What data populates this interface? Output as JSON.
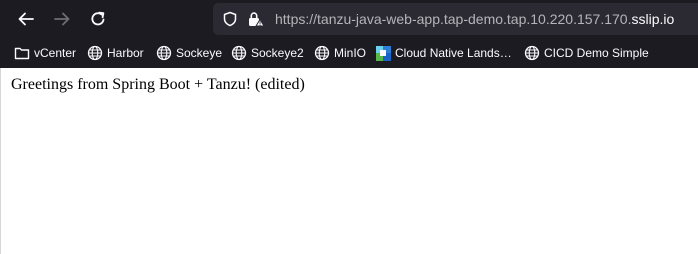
{
  "toolbar": {
    "back_icon": "arrow-left-icon",
    "forward_icon": "arrow-right-icon",
    "reload_icon": "reload-icon"
  },
  "urlbar": {
    "url_prefix": "https://tanzu-java-web-app.tap-demo.tap.10.220.157.170.",
    "url_host": "sslip.io",
    "shield_icon": "tracking-protection-shield-icon",
    "lock_icon": "lock-warning-icon"
  },
  "bookmarks": [
    {
      "label": "vCenter",
      "icon": "folder-icon"
    },
    {
      "label": "Harbor",
      "icon": "globe-icon"
    },
    {
      "label": "Sockeye",
      "icon": "globe-icon"
    },
    {
      "label": "Sockeye2",
      "icon": "globe-icon"
    },
    {
      "label": "MinIO",
      "icon": "globe-icon"
    },
    {
      "label": "Cloud Native Lands…",
      "icon": "cncf-landscape-icon"
    },
    {
      "label": "CICD Demo Simple",
      "icon": "globe-icon"
    }
  ],
  "page": {
    "greeting": "Greetings from Spring Boot + Tanzu! (edited)"
  },
  "colors": {
    "chrome_bg": "#1c1b22",
    "urlbar_bg": "#2b2a33",
    "text_light": "#fbfbfe",
    "text_dim": "#b4b4b9",
    "page_bg": "#ffffff"
  }
}
